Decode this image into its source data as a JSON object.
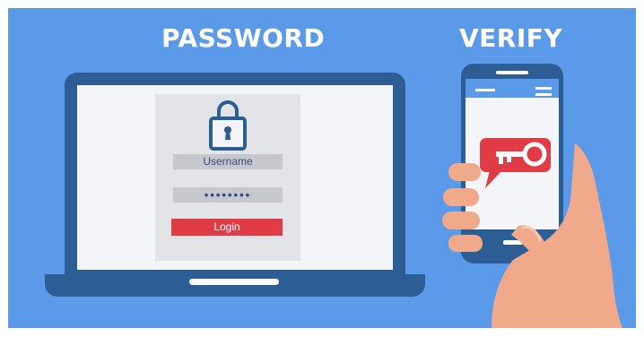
{
  "headings": {
    "password": "PASSWORD",
    "verify": "VERIFY"
  },
  "login_form": {
    "username_label": "Username",
    "password_mask": "••••••••",
    "login_label": "Login"
  },
  "icons": {
    "lock": "lock-icon",
    "key_bubble": "key-message-icon",
    "menu": "menu-icon"
  },
  "colors": {
    "background": "#5b9ae8",
    "device": "#2d5d95",
    "accent_red": "#e13b45",
    "skin": "#f0a98a"
  }
}
